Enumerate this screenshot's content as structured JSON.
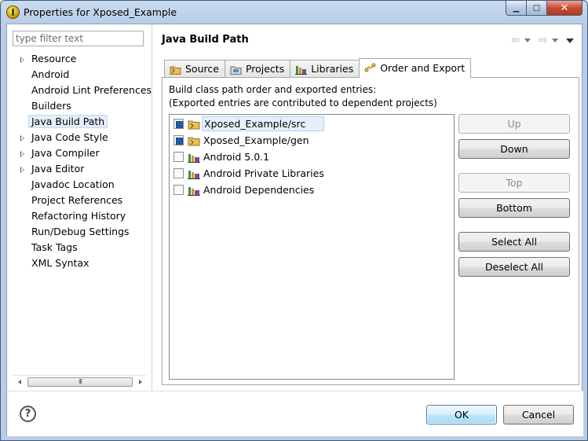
{
  "window": {
    "title": "Properties for Xposed_Example",
    "app_icon": "android-eclipse-icon",
    "controls": {
      "minimize": "minimize-icon",
      "maximize": "maximize-icon",
      "close": "close-icon"
    }
  },
  "sidebar": {
    "filter_placeholder": "type filter text",
    "items": [
      {
        "label": "Resource",
        "expandable": true
      },
      {
        "label": "Android",
        "expandable": false
      },
      {
        "label": "Android Lint Preferences",
        "expandable": false
      },
      {
        "label": "Builders",
        "expandable": false
      },
      {
        "label": "Java Build Path",
        "expandable": false,
        "selected": true
      },
      {
        "label": "Java Code Style",
        "expandable": true
      },
      {
        "label": "Java Compiler",
        "expandable": true
      },
      {
        "label": "Java Editor",
        "expandable": true
      },
      {
        "label": "Javadoc Location",
        "expandable": false
      },
      {
        "label": "Project References",
        "expandable": false
      },
      {
        "label": "Refactoring History",
        "expandable": false
      },
      {
        "label": "Run/Debug Settings",
        "expandable": false
      },
      {
        "label": "Task Tags",
        "expandable": false
      },
      {
        "label": "XML Syntax",
        "expandable": false
      }
    ],
    "scroll_thumb_label": "III"
  },
  "page": {
    "title": "Java Build Path",
    "tabs": [
      {
        "label": "Source",
        "icon": "source-folder-icon"
      },
      {
        "label": "Projects",
        "icon": "projects-icon"
      },
      {
        "label": "Libraries",
        "icon": "libraries-icon"
      },
      {
        "label": "Order and Export",
        "icon": "order-export-icon",
        "active": true
      }
    ],
    "description_line1": "Build class path order and exported entries:",
    "description_line2": "(Exported entries are contributed to dependent projects)",
    "entries": [
      {
        "label": "Xposed_Example/src",
        "checked": true,
        "icon": "source-folder-icon",
        "selected": true
      },
      {
        "label": "Xposed_Example/gen",
        "checked": true,
        "icon": "source-folder-icon"
      },
      {
        "label": "Android 5.0.1",
        "checked": false,
        "icon": "library-icon"
      },
      {
        "label": "Android Private Libraries",
        "checked": false,
        "icon": "library-icon"
      },
      {
        "label": "Android Dependencies",
        "checked": false,
        "icon": "library-icon"
      }
    ],
    "buttons": {
      "up": "Up",
      "down": "Down",
      "top": "Top",
      "bottom": "Bottom",
      "select_all": "Select All",
      "deselect_all": "Deselect All"
    }
  },
  "footer": {
    "help_symbol": "?",
    "ok": "OK",
    "cancel": "Cancel"
  },
  "colors": {
    "accent": "#3c7fb1",
    "checkbox_fill": "#1f5faa",
    "title_bar": "#b7cce6"
  }
}
